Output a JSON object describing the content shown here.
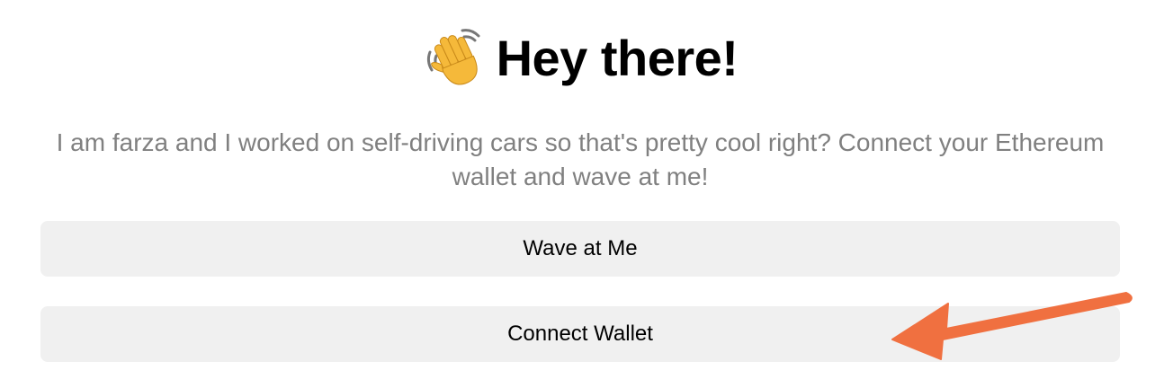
{
  "header": {
    "icon": "waving-hand-icon",
    "title": "Hey there!"
  },
  "bio": {
    "text": "I am farza and I worked on self-driving cars so that's pretty cool right? Connect your Ethereum wallet and wave at me!"
  },
  "buttons": {
    "wave_label": "Wave at Me",
    "connect_label": "Connect Wallet"
  },
  "colors": {
    "button_bg": "#f0f0f0",
    "bio_text": "#808080",
    "annotation_arrow": "#f07040",
    "hand": "#f5b93a"
  }
}
